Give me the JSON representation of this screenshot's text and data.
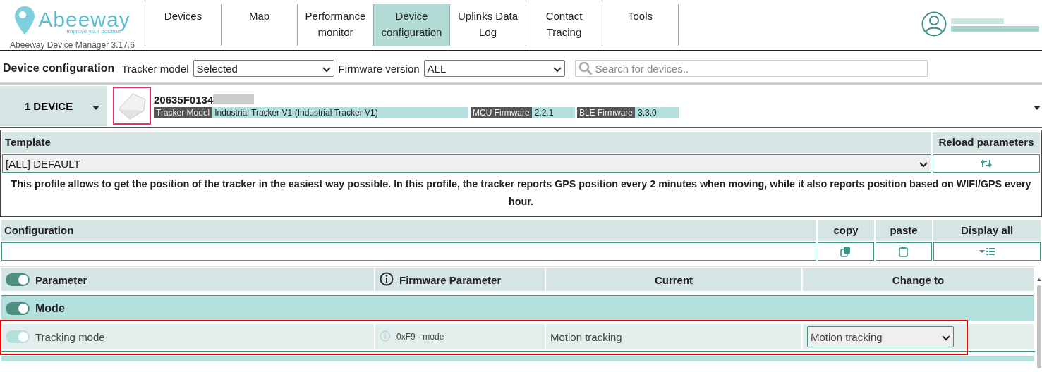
{
  "app": {
    "logo_text": "Abeeway",
    "tagline": "Improve your position",
    "version": "Abeeway Device Manager 3.17.6"
  },
  "nav": [
    {
      "label": "Devices",
      "selected": false
    },
    {
      "label": "Map",
      "selected": false
    },
    {
      "label": "Performance monitor",
      "selected": false
    },
    {
      "label": "Device configuration",
      "selected": true
    },
    {
      "label": "Uplinks Data Log",
      "selected": false
    },
    {
      "label": "Contact Tracing",
      "selected": false
    },
    {
      "label": "Tools",
      "selected": false
    }
  ],
  "toolbar": {
    "title": "Device configuration",
    "tracker_model_label": "Tracker model",
    "tracker_model": "Selected",
    "firmware_label": "Firmware version",
    "firmware": "ALL",
    "search_placeholder": "Search for devices.."
  },
  "device": {
    "count": "1 DEVICE",
    "id": "20635F0134",
    "fields": [
      {
        "label": "Tracker Model",
        "value": "Industrial Tracker V1 (Industrial Tracker V1)"
      },
      {
        "label": "MCU Firmware",
        "value": "2.2.1"
      },
      {
        "label": "BLE Firmware",
        "value": "3.3.0"
      }
    ]
  },
  "template": {
    "header": "Template",
    "reload_header": "Reload parameters",
    "value": "[ALL] DEFAULT",
    "description": "This profile allows to get the position of the tracker in the easiest way possible. In this profile, the tracker reports GPS position every 2 minutes when moving, while it also reports position based on WIFI/GPS every hour."
  },
  "configuration": {
    "header": "Configuration",
    "copy": "copy",
    "paste": "paste",
    "display_all": "Display all"
  },
  "parameters": {
    "show_all_on": true,
    "columns": [
      "Parameter",
      "Firmware Parameter",
      "Current",
      "Change to"
    ],
    "groups": [
      {
        "name": "Mode",
        "on": true,
        "rows": [
          {
            "name": "Tracking mode",
            "on": true,
            "disabled": true,
            "firmware_parameter": "0xF9 - mode",
            "current": "Motion tracking",
            "change_to": "Motion tracking",
            "highlighted": true
          }
        ]
      }
    ]
  }
}
